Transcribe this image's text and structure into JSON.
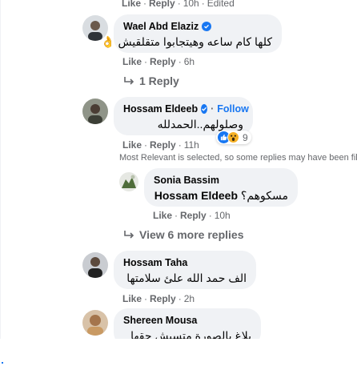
{
  "top_meta": {
    "like": "Like",
    "reply": "Reply",
    "time": "10h",
    "edited": "Edited"
  },
  "comments": [
    {
      "author": "Wael Abd Elaziz",
      "text": "كلها كام ساعه وهيتجابوا متقلقيش 👌",
      "like": "Like",
      "reply": "Reply",
      "time": "6h",
      "replies_link": "1 Reply"
    },
    {
      "author": "Hossam Eldeeb",
      "follow": "Follow",
      "text": "وصلولهم..الحمدلله",
      "like": "Like",
      "reply": "Reply",
      "time": "11h",
      "reaction_count": "9",
      "notice": "Most Relevant is selected, so some replies may have been filtered out."
    },
    {
      "author": "Sonia Bassim",
      "mention": "Hossam Eldeeb",
      "text": "مسكوهم؟",
      "like": "Like",
      "reply": "Reply",
      "time": "10h"
    },
    {
      "view_more": "View 6 more replies"
    },
    {
      "author": "Hossam Taha",
      "text": "الف حمد الله علئ سلامتها",
      "like": "Like",
      "reply": "Reply",
      "time": "2h"
    },
    {
      "author": "Shereen Mousa",
      "text": "بلاغ بالصورة متسبش حقها"
    }
  ],
  "colors": {
    "link_blue": "#1877f2",
    "bubble_bg": "#f0f2f5",
    "meta_gray": "#65676b"
  }
}
